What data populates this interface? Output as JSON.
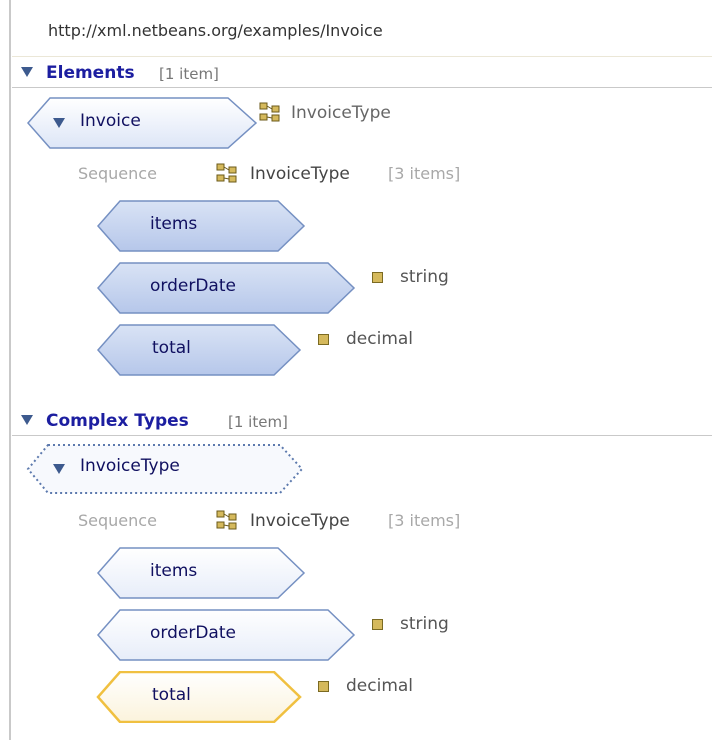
{
  "namespace": "http://xml.netbeans.org/examples/Invoice",
  "colors": {
    "section_title": "#1c1ea0",
    "selected_outline": "#f0c040",
    "element_fill": "#c5d3ef",
    "element_stroke": "#7590c2"
  },
  "elements_section": {
    "title": "Elements",
    "count": "[1 item]",
    "root": {
      "label": "Invoice",
      "type": "InvoiceType"
    },
    "sequence": {
      "label": "Sequence",
      "type": "InvoiceType",
      "count": "[3 items]",
      "children": [
        {
          "label": "items"
        },
        {
          "label": "orderDate",
          "type": "string"
        },
        {
          "label": "total",
          "type": "decimal"
        }
      ]
    }
  },
  "complex_section": {
    "title": "Complex Types",
    "count": "[1 item]",
    "root": {
      "label": "InvoiceType"
    },
    "sequence": {
      "label": "Sequence",
      "type": "InvoiceType",
      "count": "[3 items]",
      "children": [
        {
          "label": "items"
        },
        {
          "label": "orderDate",
          "type": "string"
        },
        {
          "label": "total",
          "type": "decimal",
          "selected": true
        }
      ]
    }
  },
  "icons": {
    "section_toggle": "triangle-down-icon",
    "complex_type": "complex-type-icon",
    "primitive_type": "primitive-type-icon"
  }
}
